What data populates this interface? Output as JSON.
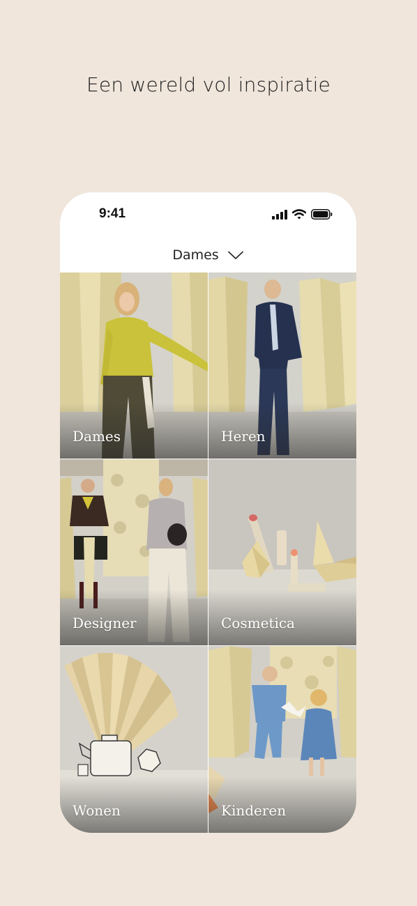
{
  "headline": "Een wereld vol inspiratie",
  "phone": {
    "status_bar": {
      "time": "9:41",
      "icons": [
        "cellular-signal-icon",
        "wifi-icon",
        "battery-icon"
      ]
    },
    "nav": {
      "selected": "Dames",
      "icon": "chevron-down-icon"
    },
    "categories": [
      {
        "label": "Dames"
      },
      {
        "label": "Heren"
      },
      {
        "label": "Designer"
      },
      {
        "label": "Cosmetica"
      },
      {
        "label": "Wonen"
      },
      {
        "label": "Kinderen"
      }
    ]
  },
  "colors": {
    "background": "#f0e6dc",
    "phone": "#ffffff",
    "text": "#1e1e1e",
    "paper": "#e8dcae"
  }
}
